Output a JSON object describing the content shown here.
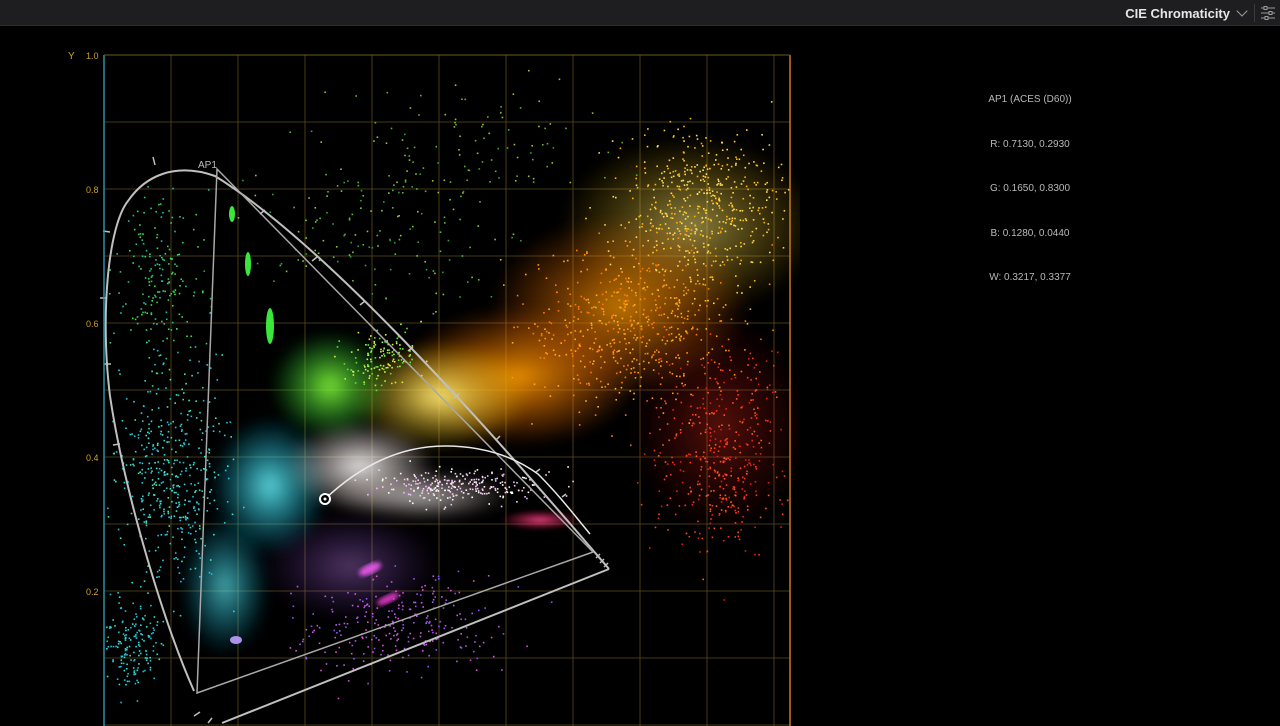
{
  "header": {
    "scope_label": "CIE Chromaticity",
    "dropdown_icon": "chevron-down-icon",
    "settings_icon": "sliders-icon"
  },
  "chart": {
    "y_axis_letter": "Y",
    "y_tick_labels": [
      "1.0",
      "0.8",
      "0.6",
      "0.4",
      "0.2"
    ],
    "gamut_label": "AP1",
    "colors": {
      "grid": "#5a4a1c",
      "tick_label": "#c9a22a",
      "locus": "#bdbdbd",
      "background": "#000000"
    }
  },
  "info": {
    "title": "AP1 (ACES (D60))",
    "red": "R: 0.7130, 0.2930",
    "green": "G: 0.1650, 0.8300",
    "blue": "B: 0.1280, 0.0440",
    "white": "W: 0.3217, 0.3377"
  }
}
